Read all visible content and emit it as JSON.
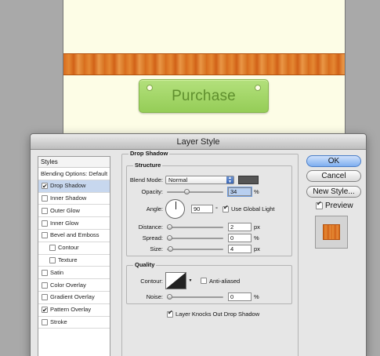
{
  "canvas": {
    "purchase_label": "Purchase"
  },
  "dialog": {
    "title": "Layer Style",
    "styles_header": "Styles",
    "styles": [
      {
        "label": "Blending Options: Default",
        "checkbox": false,
        "checked": false,
        "sub": false,
        "selected": false
      },
      {
        "label": "Drop Shadow",
        "checkbox": true,
        "checked": true,
        "sub": false,
        "selected": true
      },
      {
        "label": "Inner Shadow",
        "checkbox": true,
        "checked": false,
        "sub": false,
        "selected": false
      },
      {
        "label": "Outer Glow",
        "checkbox": true,
        "checked": false,
        "sub": false,
        "selected": false
      },
      {
        "label": "Inner Glow",
        "checkbox": true,
        "checked": false,
        "sub": false,
        "selected": false
      },
      {
        "label": "Bevel and Emboss",
        "checkbox": true,
        "checked": false,
        "sub": false,
        "selected": false
      },
      {
        "label": "Contour",
        "checkbox": true,
        "checked": false,
        "sub": true,
        "selected": false
      },
      {
        "label": "Texture",
        "checkbox": true,
        "checked": false,
        "sub": true,
        "selected": false
      },
      {
        "label": "Satin",
        "checkbox": true,
        "checked": false,
        "sub": false,
        "selected": false
      },
      {
        "label": "Color Overlay",
        "checkbox": true,
        "checked": false,
        "sub": false,
        "selected": false
      },
      {
        "label": "Gradient Overlay",
        "checkbox": true,
        "checked": false,
        "sub": false,
        "selected": false
      },
      {
        "label": "Pattern Overlay",
        "checkbox": true,
        "checked": true,
        "sub": false,
        "selected": false
      },
      {
        "label": "Stroke",
        "checkbox": true,
        "checked": false,
        "sub": false,
        "selected": false
      }
    ],
    "drop_shadow": {
      "section_title": "Drop Shadow",
      "structure_legend": "Structure",
      "blend_mode_label": "Blend Mode:",
      "blend_mode_value": "Normal",
      "shadow_color": "#555555",
      "opacity_label": "Opacity:",
      "opacity_value": "34",
      "opacity_fraction": 0.34,
      "opacity_unit": "%",
      "angle_label": "Angle:",
      "angle_value": "90",
      "angle_unit": "°",
      "use_global_light_label": "Use Global Light",
      "use_global_light_checked": true,
      "distance_label": "Distance:",
      "distance_value": "2",
      "distance_unit": "px",
      "spread_label": "Spread:",
      "spread_value": "0",
      "spread_unit": "%",
      "size_label": "Size:",
      "size_value": "4",
      "size_unit": "px",
      "quality_legend": "Quality",
      "contour_label": "Contour:",
      "anti_aliased_label": "Anti-aliased",
      "anti_aliased_checked": false,
      "noise_label": "Noise:",
      "noise_value": "0",
      "noise_unit": "%",
      "knockout_label": "Layer Knocks Out Drop Shadow",
      "knockout_checked": true
    },
    "buttons": {
      "ok": "OK",
      "cancel": "Cancel",
      "new_style": "New Style...",
      "preview_label": "Preview",
      "preview_checked": true
    }
  }
}
